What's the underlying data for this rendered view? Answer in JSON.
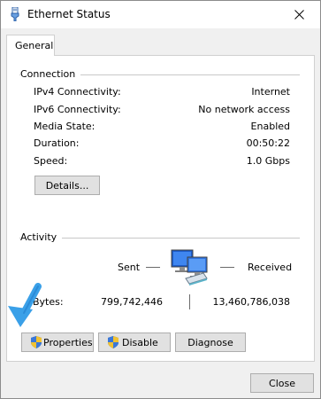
{
  "window": {
    "title": "Ethernet Status"
  },
  "tabs": [
    {
      "label": "General"
    }
  ],
  "connection": {
    "heading": "Connection",
    "rows": [
      {
        "label": "IPv4 Connectivity:",
        "value": "Internet"
      },
      {
        "label": "IPv6 Connectivity:",
        "value": "No network access"
      },
      {
        "label": "Media State:",
        "value": "Enabled"
      },
      {
        "label": "Duration:",
        "value": "00:50:22"
      },
      {
        "label": "Speed:",
        "value": "1.0 Gbps"
      }
    ],
    "details_button": "Details..."
  },
  "activity": {
    "heading": "Activity",
    "sent_label": "Sent",
    "received_label": "Received",
    "bytes_label": "Bytes:",
    "bytes_sent": "799,742,446",
    "bytes_received": "13,460,786,038"
  },
  "actions": {
    "properties": "Properties",
    "disable": "Disable",
    "diagnose": "Diagnose"
  },
  "footer": {
    "close": "Close"
  },
  "icons": {
    "title": "ethernet-plug-icon",
    "network": "network-computers-icon",
    "shield": "uac-shield-icon",
    "annotation": "blue-arrow-annotation"
  }
}
